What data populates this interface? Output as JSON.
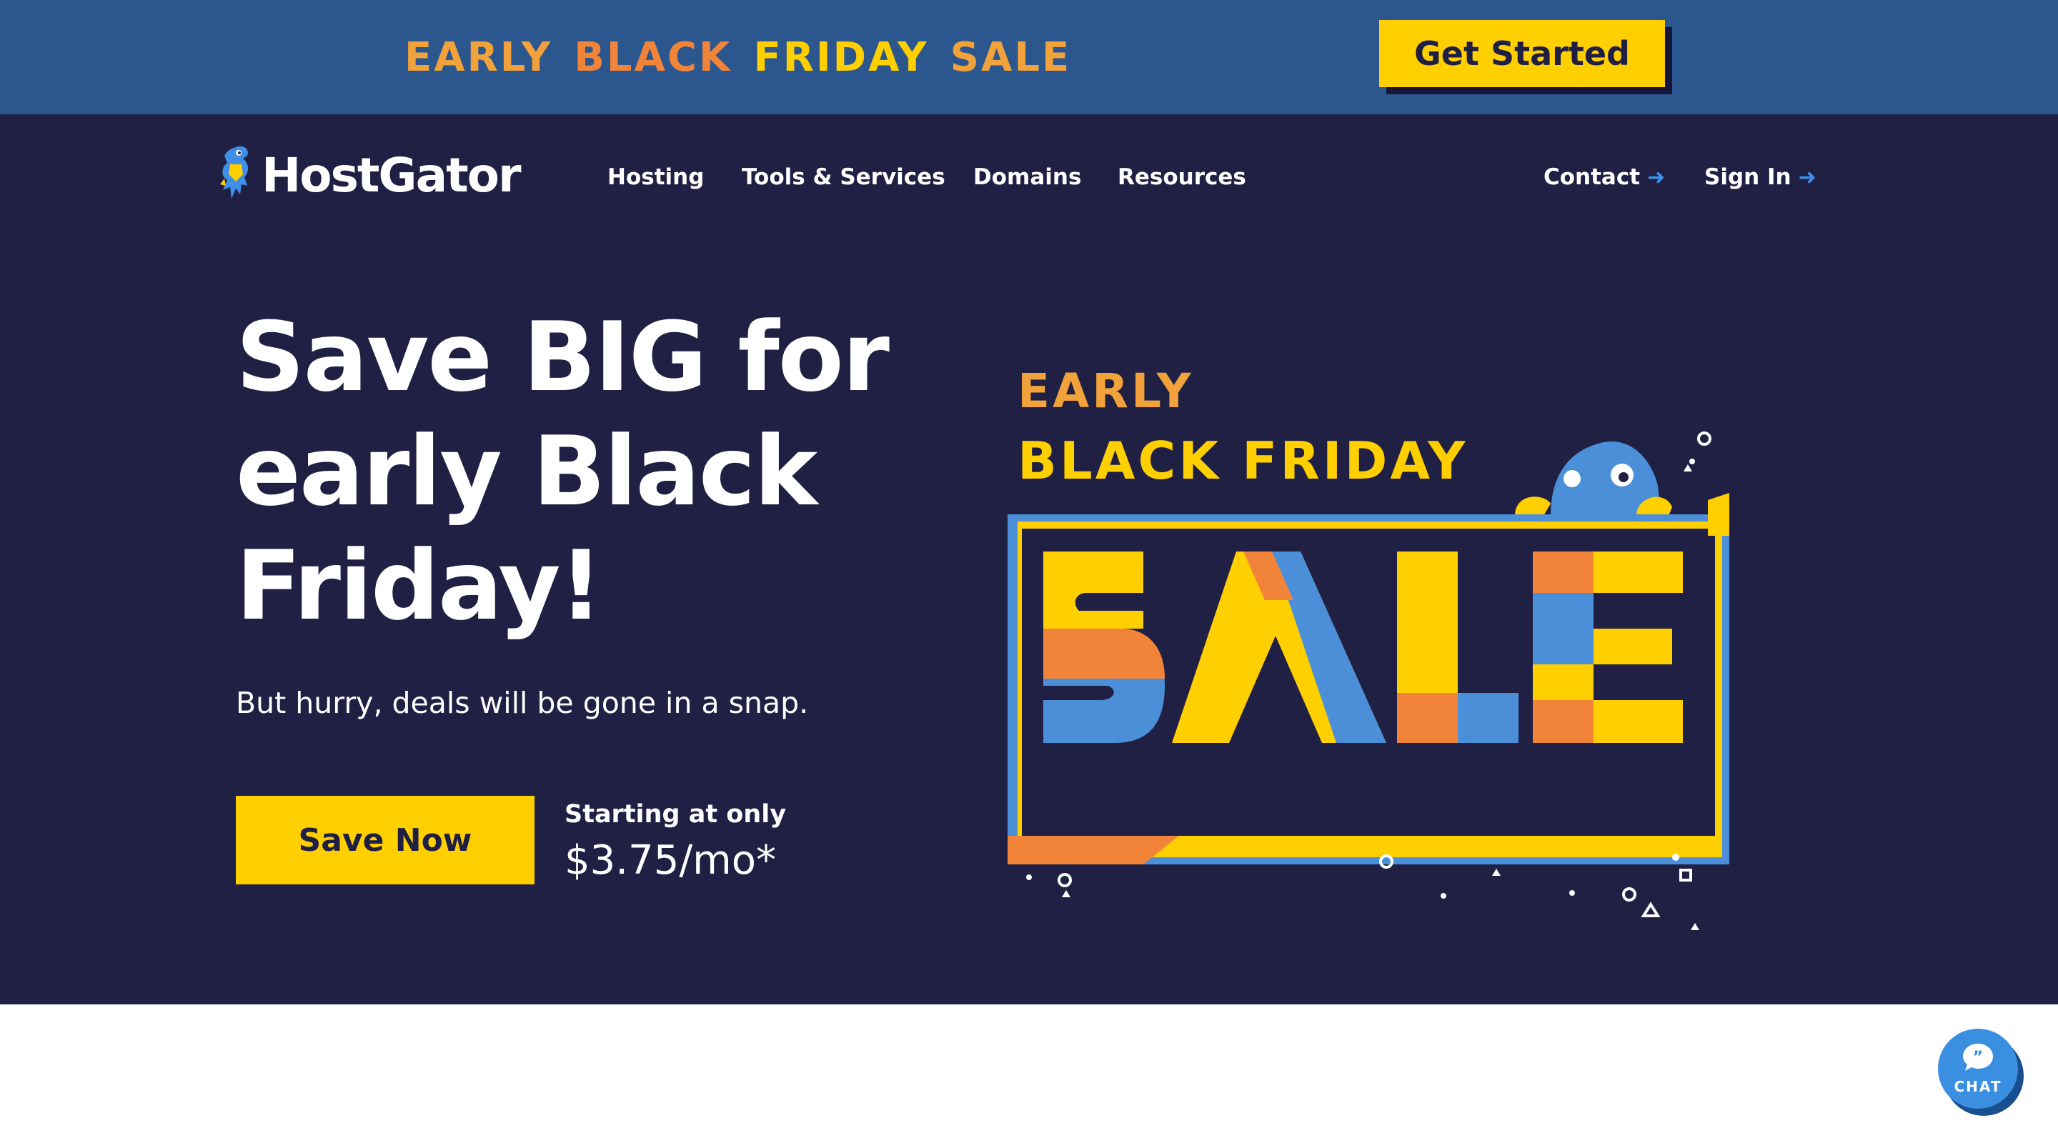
{
  "promo": {
    "words": [
      "EARLY",
      "BLACK",
      "FRIDAY",
      "SALE"
    ],
    "word_colors": [
      "#f2a23a",
      "#f2843a",
      "#ffcf00",
      "#f2a23a"
    ],
    "button_label": "Get Started"
  },
  "brand": {
    "name": "HostGator",
    "icon": "gator-mascot-icon"
  },
  "nav": {
    "items": [
      "Hosting",
      "Tools & Services",
      "Domains",
      "Resources"
    ],
    "contact": "Contact",
    "sign_in": "Sign In",
    "arrow_icon": "arrow-right-icon"
  },
  "hero": {
    "title_lines": [
      "Save BIG for",
      "early Black",
      "Friday!"
    ],
    "subtitle": "But hurry, deals will be gone in a snap.",
    "cta_label": "Save Now",
    "price_label": "Starting at only",
    "price": "$3.75/mo*"
  },
  "sale_graphic": {
    "line1": "EARLY",
    "line2": "BLACK FRIDAY",
    "big_word": "SALE",
    "mascot_icon": "gator-peeking-icon"
  },
  "chat": {
    "label": "CHAT",
    "icon": "chat-bubble-icon"
  },
  "colors": {
    "promo_bg": "#2c578e",
    "hero_bg": "#1f2044",
    "accent_yellow": "#ffcf00",
    "accent_orange": "#f2843a",
    "accent_blue": "#4a8fd8",
    "chat_blue": "#3a8fe0"
  }
}
